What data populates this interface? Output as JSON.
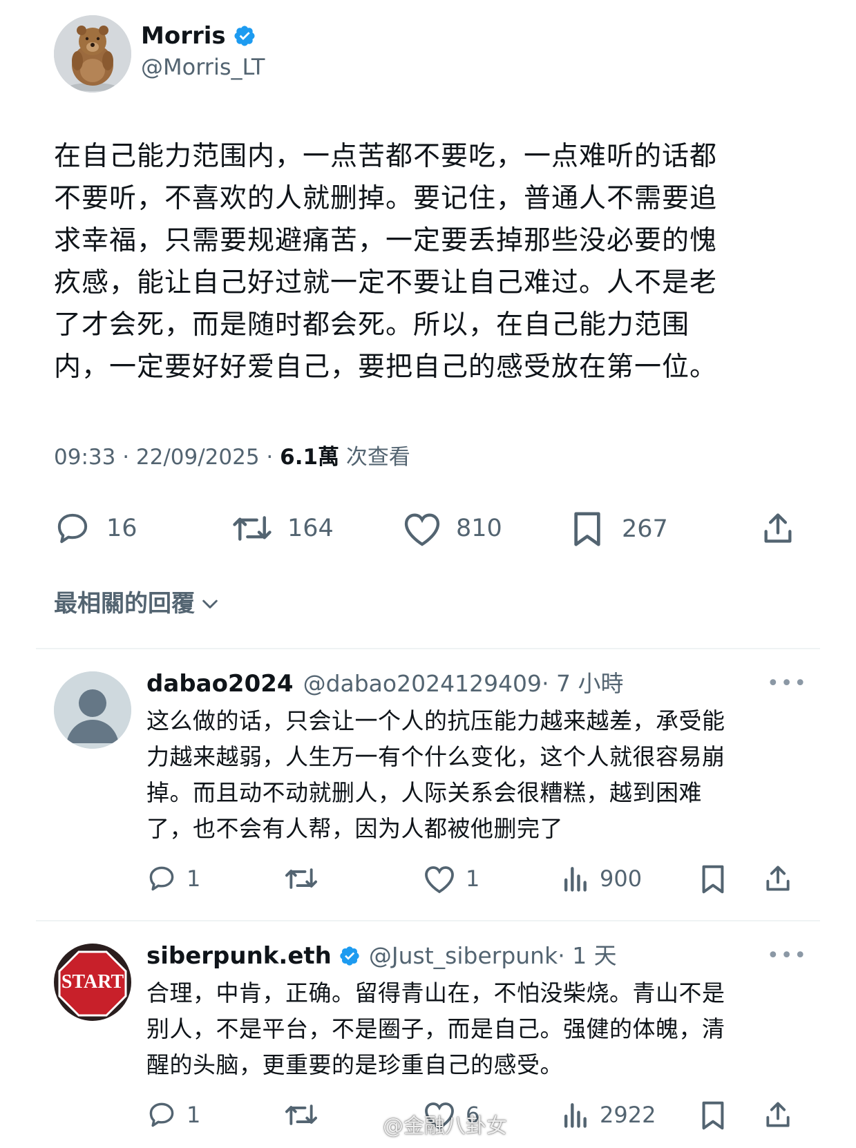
{
  "tweet": {
    "author": {
      "name": "Morris",
      "handle": "@Morris_LT",
      "verified": true,
      "avatar_icon": "bear-avatar"
    },
    "text_lines": [
      "在自己能力范围内，一点苦都不要吃，一点难听的话都",
      "不要听，不喜欢的人就删掉。要记住，普通人不需要追",
      "求幸福，只需要规避痛苦，一定要丢掉那些没必要的愧",
      "疚感，能让自己好过就一定不要让自己难过。人不是老",
      "了才会死，而是随时都会死。所以，在自己能力范围",
      "内，一定要好好爱自己，要把自己的感受放在第一位。"
    ],
    "time": "09:33 · 22/09/2025 · ",
    "views": "6.1萬",
    "views_label": " 次查看",
    "actions": {
      "replies": "16",
      "retweets": "164",
      "likes": "810",
      "bookmarks": "267"
    }
  },
  "sort_label": "最相關的回覆",
  "replies": [
    {
      "name": "dabao2024",
      "handle": "@dabao2024129409",
      "time": " · 7 小時",
      "verified": false,
      "avatar_icon": "default-user-avatar",
      "text_lines": [
        "这么做的话，只会让一个人的抗压能力越来越差，承受能",
        "力越来越弱，人生万一有个什么变化，这个人就很容易崩",
        "掉。而且动不动就删人，人际关系会很糟糕，越到困难",
        "了，也不会有人帮，因为人都被他删完了"
      ],
      "actions": {
        "replies": "1",
        "retweets": "",
        "likes": "1",
        "views": "900"
      }
    },
    {
      "name": "siberpunk.eth",
      "handle": "@Just_siberpunk",
      "time": " · 1 天",
      "verified": true,
      "avatar_icon": "start-sign-avatar",
      "avatar_text": "START",
      "text_lines": [
        "合理，中肯，正确。留得青山在，不怕没柴烧。青山不是",
        "别人，不是平台，不是圈子，而是自己。强健的体魄，清",
        "醒的头脑，更重要的是珍重自己的感受。"
      ],
      "actions": {
        "replies": "1",
        "retweets": "",
        "likes": "6",
        "views": "2922"
      }
    }
  ],
  "more_label": "•••",
  "watermark": "@金融八卦女",
  "colors": {
    "text": "#0f1419",
    "secondary": "#536471",
    "verified": "#1d9bf0",
    "divider": "#eff3f4"
  }
}
